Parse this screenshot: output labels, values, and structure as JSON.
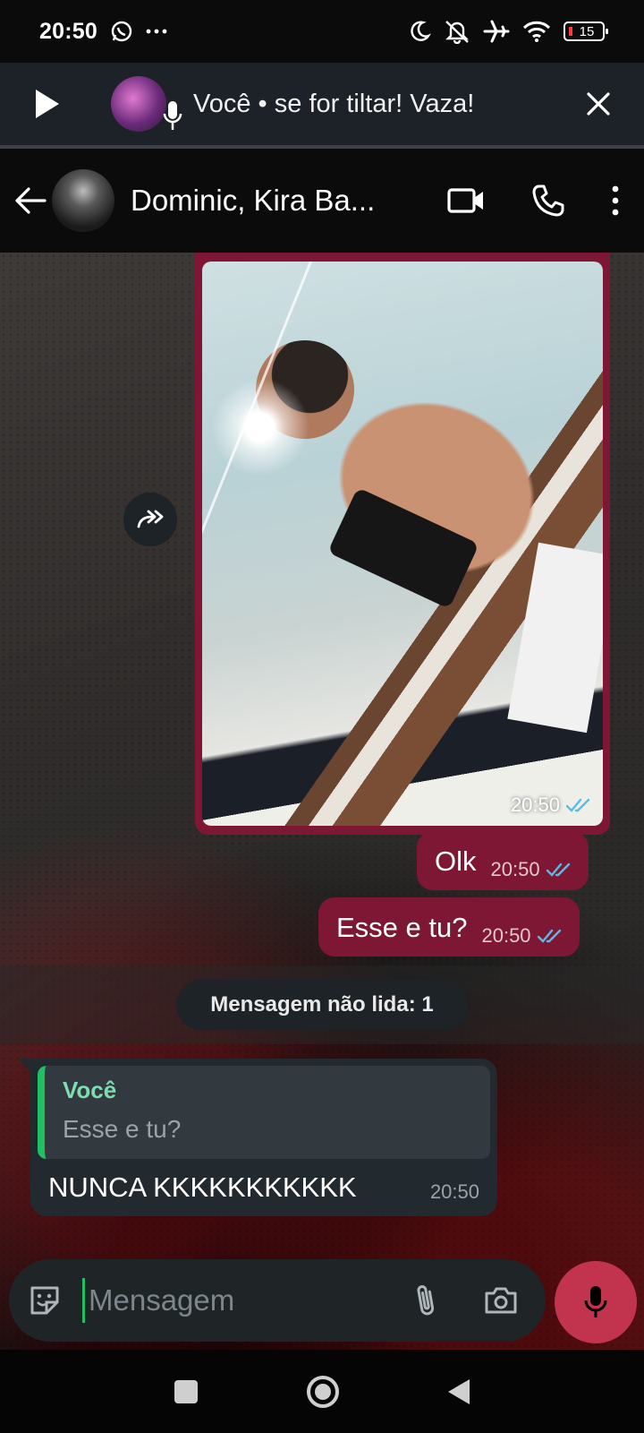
{
  "status_bar": {
    "time": "20:50",
    "battery": "15",
    "icons": [
      "whatsapp-icon",
      "more-dots-icon",
      "moon-icon",
      "muted-bell-icon",
      "airplane-icon",
      "wifi-icon",
      "battery-icon"
    ]
  },
  "voice_banner": {
    "text": "Você • se for tiltar! Vaza!"
  },
  "header": {
    "title": "Dominic, Kira Ba..."
  },
  "messages": {
    "photo": {
      "time": "20:50"
    },
    "out": [
      {
        "text": "Olk",
        "time": "20:50"
      },
      {
        "text": "Esse e tu?",
        "time": "20:50"
      }
    ],
    "unread": "Mensagem não lida: 1",
    "incoming": {
      "quote_author": "Você",
      "quote_text": "Esse e tu?",
      "text": "NUNCA KKKKKKKKKKK",
      "time": "20:50"
    }
  },
  "composer": {
    "placeholder": "Mensagem"
  },
  "colors": {
    "out_bubble": "#7e1733",
    "in_bubble": "#232a2f",
    "accent_green": "#21c063",
    "mic_button": "#c2334d",
    "read_ticks": "#53bdeb"
  }
}
